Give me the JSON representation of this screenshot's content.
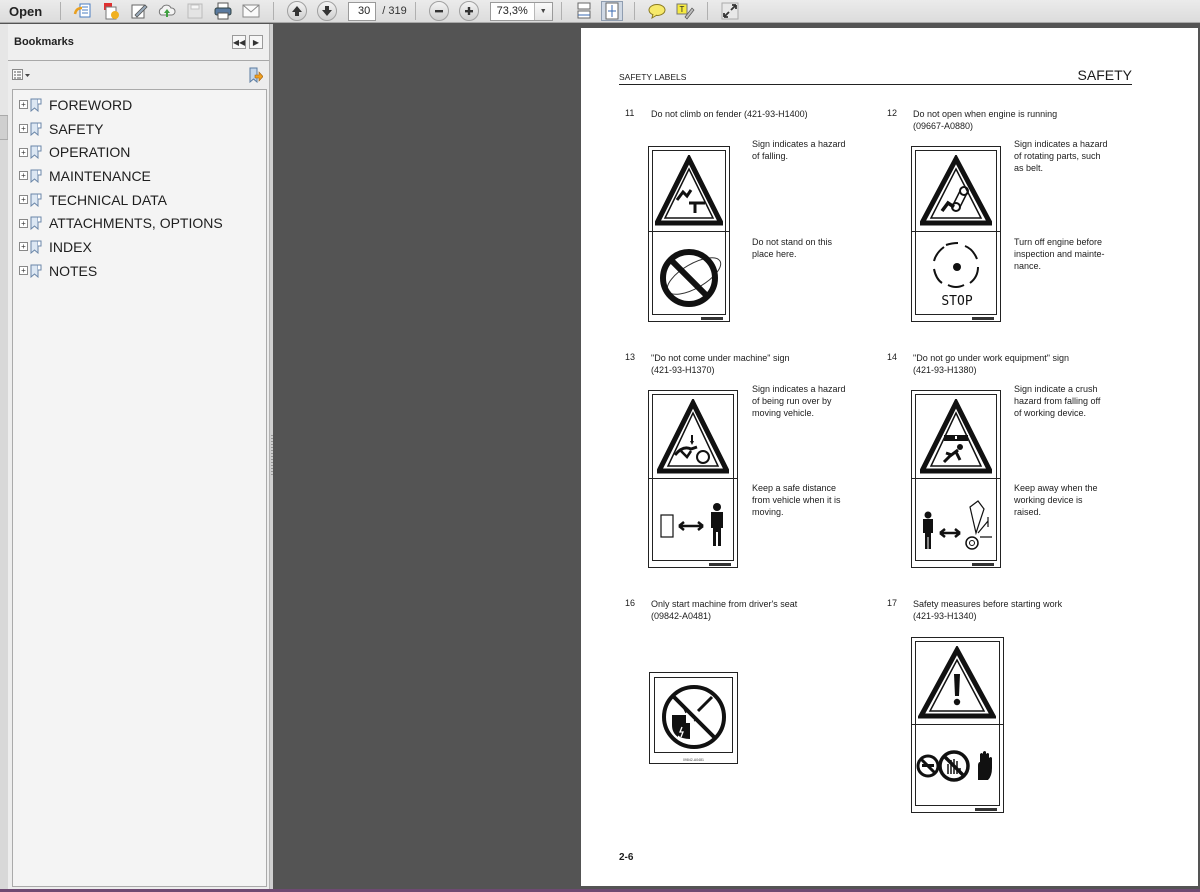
{
  "toolbar": {
    "open_label": "Open",
    "current_page": "30",
    "total_pages": "/ 319",
    "zoom_level": "73,3%",
    "icons": [
      "create-pdf-icon",
      "combine-files-icon",
      "sign-edit-icon",
      "upload-cloud-icon",
      "save-icon",
      "print-icon",
      "email-icon",
      "previous-page-icon",
      "next-page-icon",
      "zoom-out-icon",
      "zoom-in-icon",
      "fit-width-scroll-icon",
      "fit-page-icon",
      "comment-icon",
      "highlight-text-icon",
      "full-screen-icon"
    ]
  },
  "sidebar": {
    "title": "Bookmarks",
    "collapse_label": "◀◀",
    "expand_label": "▶",
    "options_icon": "options-menu-icon",
    "items": [
      {
        "label": "FOREWORD"
      },
      {
        "label": "SAFETY"
      },
      {
        "label": "OPERATION"
      },
      {
        "label": "MAINTENANCE"
      },
      {
        "label": "TECHNICAL DATA"
      },
      {
        "label": "ATTACHMENTS, OPTIONS"
      },
      {
        "label": "INDEX"
      },
      {
        "label": "NOTES"
      }
    ]
  },
  "document": {
    "header_left": "SAFETY LABELS",
    "header_right": "SAFETY",
    "page_number": "2-6",
    "labels": [
      {
        "num": "11",
        "title_lines": [
          "Do not climb on fender (421-93-H1400)"
        ],
        "desc_top": [
          "Sign indicates a hazard",
          "of falling."
        ],
        "desc_bottom": [
          "Do not stand on this",
          "place here."
        ]
      },
      {
        "num": "12",
        "title_lines": [
          "Do not open when engine is running",
          "(09667-A0880)"
        ],
        "desc_top": [
          "Sign indicates a hazard",
          "of rotating parts, such",
          "as belt."
        ],
        "desc_bottom": [
          "Turn off engine before",
          "inspection and mainte-",
          "nance."
        ],
        "stop_text": "STOP"
      },
      {
        "num": "13",
        "title_lines": [
          "\"Do not come under machine\" sign",
          "(421-93-H1370)"
        ],
        "desc_top": [
          "Sign indicates a hazard",
          "of being run over by",
          "moving vehicle."
        ],
        "desc_bottom": [
          "Keep a safe distance",
          "from vehicle when it is",
          "moving."
        ]
      },
      {
        "num": "14",
        "title_lines": [
          "\"Do not go under work equipment\" sign",
          "(421-93-H1380)"
        ],
        "desc_top": [
          "Sign indicate a crush",
          "hazard from falling off",
          "of working device."
        ],
        "desc_bottom": [
          "Keep away when the",
          "working device is",
          "raised."
        ]
      },
      {
        "num": "16",
        "title_lines": [
          "Only start machine from driver's seat",
          "(09842-A0481)"
        ],
        "sign_code": "09842-A0481"
      },
      {
        "num": "17",
        "title_lines": [
          "Safety measures before starting work",
          "(421-93-H1340)"
        ]
      }
    ]
  }
}
